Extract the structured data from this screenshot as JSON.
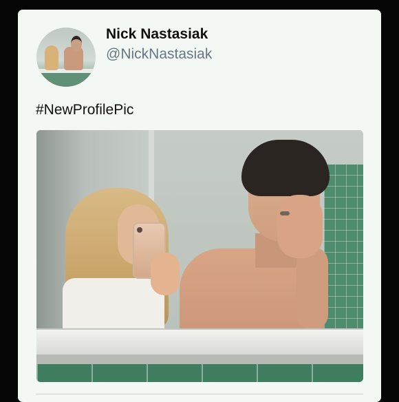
{
  "tweet": {
    "display_name": "Nick Nastasiak",
    "handle": "@NickNastasiak",
    "text": "#NewProfilePic"
  },
  "colors": {
    "background": "#050505",
    "card": "#f4f8f4",
    "name": "#101010",
    "handle": "#657786"
  },
  "icons": {
    "avatar": "profile-photo"
  }
}
